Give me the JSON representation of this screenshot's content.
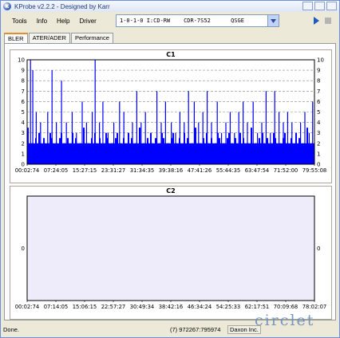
{
  "window": {
    "title": "KProbe v2.2.2 - Designed by Karr"
  },
  "menu": {
    "items": [
      "Tools",
      "Info",
      "Help",
      "Driver"
    ]
  },
  "drive_select": {
    "value": "1-0-1-0 I:CD-RW    CDR-7S52      QSGE"
  },
  "tabs": [
    "BLER",
    "ATER/ADER",
    "Performance"
  ],
  "status": {
    "left": "Done.",
    "mid": "(7) 972267:795974",
    "right": "Daxon Inc."
  },
  "watermark": "circlet",
  "chart_data": [
    {
      "type": "bar",
      "title": "C1",
      "ylim": [
        0,
        10
      ],
      "y_ticks": [
        0,
        1,
        2,
        3,
        4,
        5,
        6,
        7,
        8,
        9,
        10
      ],
      "x_tick_labels": [
        "00:02:74",
        "07:24:05",
        "15:27:15",
        "23:31:27",
        "31:34:35",
        "39:38:16",
        "47:41:26",
        "55:44:35",
        "63:47:54",
        "71:52:00",
        "79:55:08"
      ],
      "grid": true,
      "bar_color": "#0000ff",
      "baseline": 2,
      "spikes": [
        [
          0.01,
          10
        ],
        [
          0.018,
          9
        ],
        [
          0.03,
          5
        ],
        [
          0.045,
          4
        ],
        [
          0.07,
          5
        ],
        [
          0.085,
          9
        ],
        [
          0.1,
          4
        ],
        [
          0.118,
          8
        ],
        [
          0.135,
          4
        ],
        [
          0.155,
          5
        ],
        [
          0.17,
          3
        ],
        [
          0.19,
          6
        ],
        [
          0.205,
          4
        ],
        [
          0.225,
          5
        ],
        [
          0.235,
          10
        ],
        [
          0.25,
          4
        ],
        [
          0.262,
          6
        ],
        [
          0.28,
          3
        ],
        [
          0.3,
          4
        ],
        [
          0.32,
          6
        ],
        [
          0.335,
          5
        ],
        [
          0.35,
          3
        ],
        [
          0.365,
          4
        ],
        [
          0.38,
          7
        ],
        [
          0.395,
          4
        ],
        [
          0.41,
          5
        ],
        [
          0.43,
          3
        ],
        [
          0.45,
          7
        ],
        [
          0.465,
          4
        ],
        [
          0.48,
          6
        ],
        [
          0.5,
          4
        ],
        [
          0.515,
          3
        ],
        [
          0.53,
          5
        ],
        [
          0.545,
          4
        ],
        [
          0.56,
          7
        ],
        [
          0.58,
          6
        ],
        [
          0.595,
          4
        ],
        [
          0.61,
          5
        ],
        [
          0.625,
          7
        ],
        [
          0.64,
          4
        ],
        [
          0.66,
          6
        ],
        [
          0.675,
          3
        ],
        [
          0.69,
          4
        ],
        [
          0.705,
          5
        ],
        [
          0.72,
          3
        ],
        [
          0.735,
          5
        ],
        [
          0.75,
          6
        ],
        [
          0.765,
          4
        ],
        [
          0.785,
          6
        ],
        [
          0.8,
          3
        ],
        [
          0.815,
          4
        ],
        [
          0.83,
          7
        ],
        [
          0.845,
          3
        ],
        [
          0.86,
          7
        ],
        [
          0.875,
          5
        ],
        [
          0.89,
          4
        ],
        [
          0.905,
          5
        ],
        [
          0.92,
          4
        ],
        [
          0.935,
          3
        ],
        [
          0.95,
          4
        ],
        [
          0.965,
          5
        ],
        [
          0.98,
          3
        ],
        [
          0.992,
          6
        ]
      ]
    },
    {
      "type": "bar",
      "title": "C2",
      "ylim": [
        -1,
        1
      ],
      "y_ticks": [
        0
      ],
      "x_tick_labels": [
        "00:02:74",
        "07:14:05",
        "15:06:15",
        "22:57:27",
        "30:49:34",
        "38:42:16",
        "46:34:24",
        "54:25:33",
        "62:17:51",
        "70:09:68",
        "78:02:07"
      ],
      "grid": false,
      "values": []
    }
  ],
  "colors": {
    "bar": "#0000ff",
    "c2_plot_bg": "#eeecfa"
  }
}
